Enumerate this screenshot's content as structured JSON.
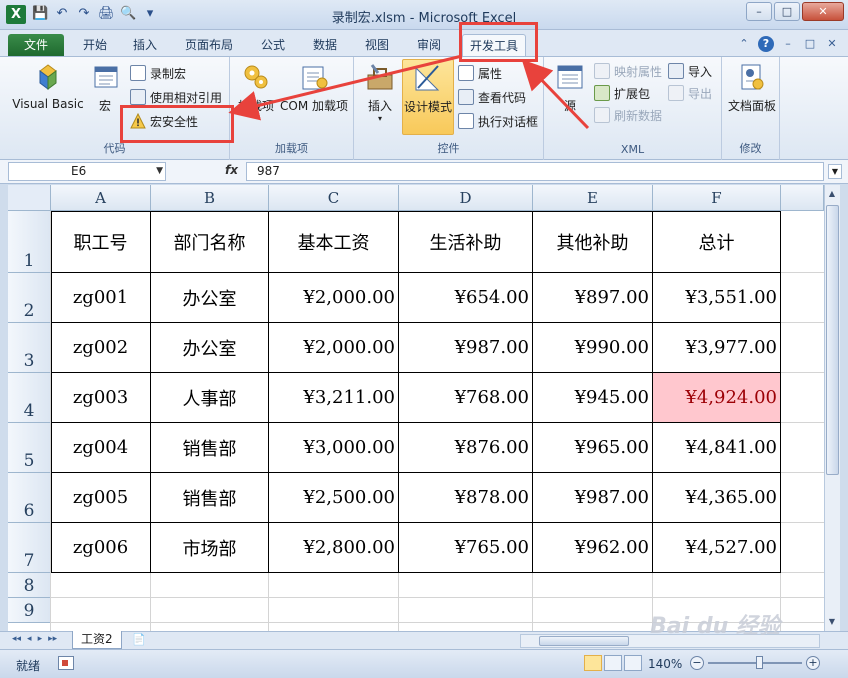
{
  "window": {
    "title": "录制宏.xlsm - Microsoft Excel",
    "logo": "X",
    "controls": {
      "minimize": "–",
      "maximize": "□",
      "close": "✕"
    }
  },
  "qat": {
    "save_icon": "💾",
    "undo_icon": "↶",
    "redo_icon": "↷",
    "print_icon": "🖨",
    "preview_icon": "🔍",
    "more_icon": "▾"
  },
  "tabs": [
    {
      "label": "文件"
    },
    {
      "label": "开始"
    },
    {
      "label": "插入"
    },
    {
      "label": "页面布局"
    },
    {
      "label": "公式"
    },
    {
      "label": "数据"
    },
    {
      "label": "视图"
    },
    {
      "label": "审阅"
    },
    {
      "label": "开发工具"
    }
  ],
  "tab_right": {
    "collapse": "⌃",
    "help": "?",
    "min": "–",
    "restore": "□",
    "close": "✕"
  },
  "ribbon": {
    "code": {
      "label": "代码",
      "visual_basic": "Visual Basic",
      "macros": "宏",
      "record_macro": "录制宏",
      "relative_ref": "使用相对引用",
      "macro_security": "宏安全性"
    },
    "addins": {
      "label": "加载项",
      "addins": "加载项",
      "com_addins": "COM 加载项"
    },
    "controls": {
      "label": "控件",
      "insert": "插入",
      "design_mode": "设计模式",
      "properties": "属性",
      "view_code": "查看代码",
      "run_dialog": "执行对话框"
    },
    "xml": {
      "label": "XML",
      "source": "源",
      "map_properties": "映射属性",
      "expansion_packs": "扩展包",
      "refresh_data": "刷新数据",
      "import": "导入",
      "export": "导出"
    },
    "modify": {
      "label": "修改",
      "document_panel": "文档面板"
    }
  },
  "formula_bar": {
    "name_box": "E6",
    "fx": "fx",
    "value": "987"
  },
  "grid": {
    "columns": [
      "A",
      "B",
      "C",
      "D",
      "E",
      "F"
    ],
    "row_numbers": [
      "1",
      "2",
      "3",
      "4",
      "5",
      "6",
      "7",
      "8",
      "9"
    ],
    "header": [
      "职工号",
      "部门名称",
      "基本工资",
      "生活补助",
      "其他补助",
      "总计"
    ],
    "rows": [
      [
        "zg001",
        "办公室",
        "¥2,000.00",
        "¥654.00",
        "¥897.00",
        "¥3,551.00"
      ],
      [
        "zg002",
        "办公室",
        "¥2,000.00",
        "¥987.00",
        "¥990.00",
        "¥3,977.00"
      ],
      [
        "zg003",
        "人事部",
        "¥3,211.00",
        "¥768.00",
        "¥945.00",
        "¥4,924.00"
      ],
      [
        "zg004",
        "销售部",
        "¥3,000.00",
        "¥876.00",
        "¥965.00",
        "¥4,841.00"
      ],
      [
        "zg005",
        "销售部",
        "¥2,500.00",
        "¥878.00",
        "¥987.00",
        "¥4,365.00"
      ],
      [
        "zg006",
        "市场部",
        "¥2,800.00",
        "¥765.00",
        "¥962.00",
        "¥4,527.00"
      ]
    ],
    "highlight_color": "#ffc7ce"
  },
  "sheets": {
    "nav": [
      "◂◂",
      "◂",
      "▸",
      "▸▸"
    ],
    "active": "工资2",
    "new_sheet_icon": "📄"
  },
  "status": {
    "ready": "就绪",
    "zoom": "140%",
    "zoom_minus": "−",
    "zoom_plus": "+"
  },
  "watermark": "Bai du 经验"
}
